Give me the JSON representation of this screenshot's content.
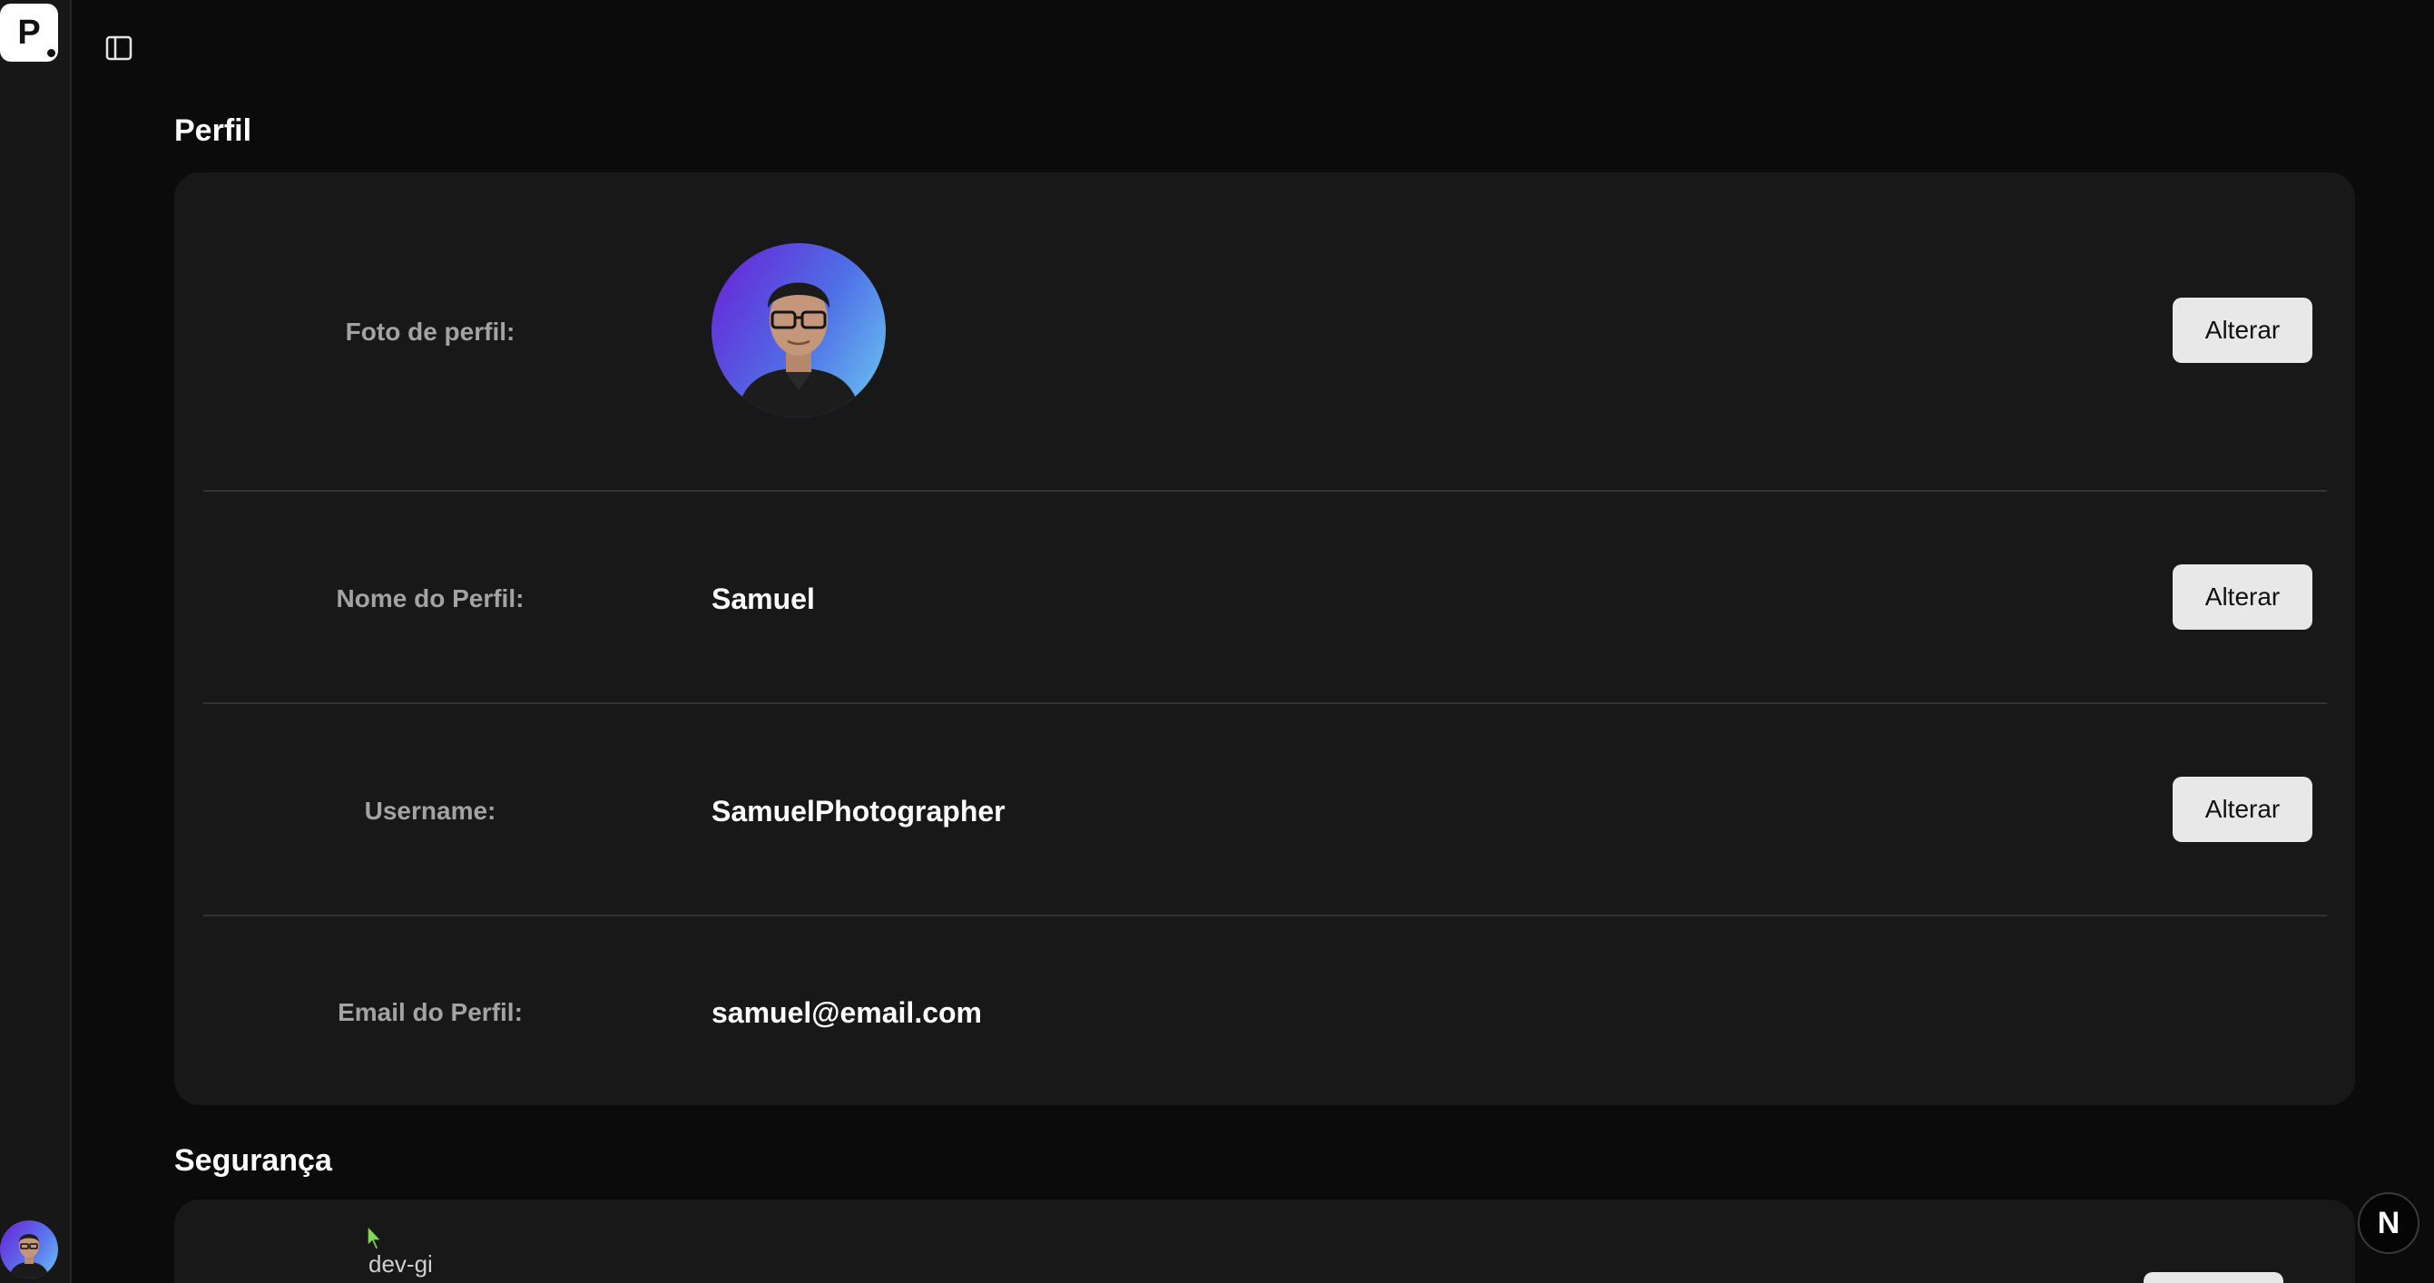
{
  "app": {
    "logo_letter": "P",
    "sidebar_toggle_icon": "sidebar-panel-icon"
  },
  "perfil": {
    "title": "Perfil",
    "rows": [
      {
        "label": "Foto de perfil:",
        "value": "",
        "button": "Alterar"
      },
      {
        "label": "Nome do Perfil:",
        "value": "Samuel",
        "button": "Alterar"
      },
      {
        "label": "Username:",
        "value": "SamuelPhotographer",
        "button": "Alterar"
      },
      {
        "label": "Email do Perfil:",
        "value": "samuel@email.com",
        "button": ""
      }
    ]
  },
  "seguranca": {
    "title": "Segurança"
  },
  "overlay": {
    "cursor_label": "dev-gi",
    "n_badge": "N"
  },
  "colors": {
    "background": "#0b0b0b",
    "card": "#181818",
    "sidebar": "#171717",
    "label": "#a3a3a3",
    "button_bg": "#e8e8e8",
    "avatar_gradient_start": "#6a1fd6",
    "avatar_gradient_end": "#6ccaf3"
  }
}
